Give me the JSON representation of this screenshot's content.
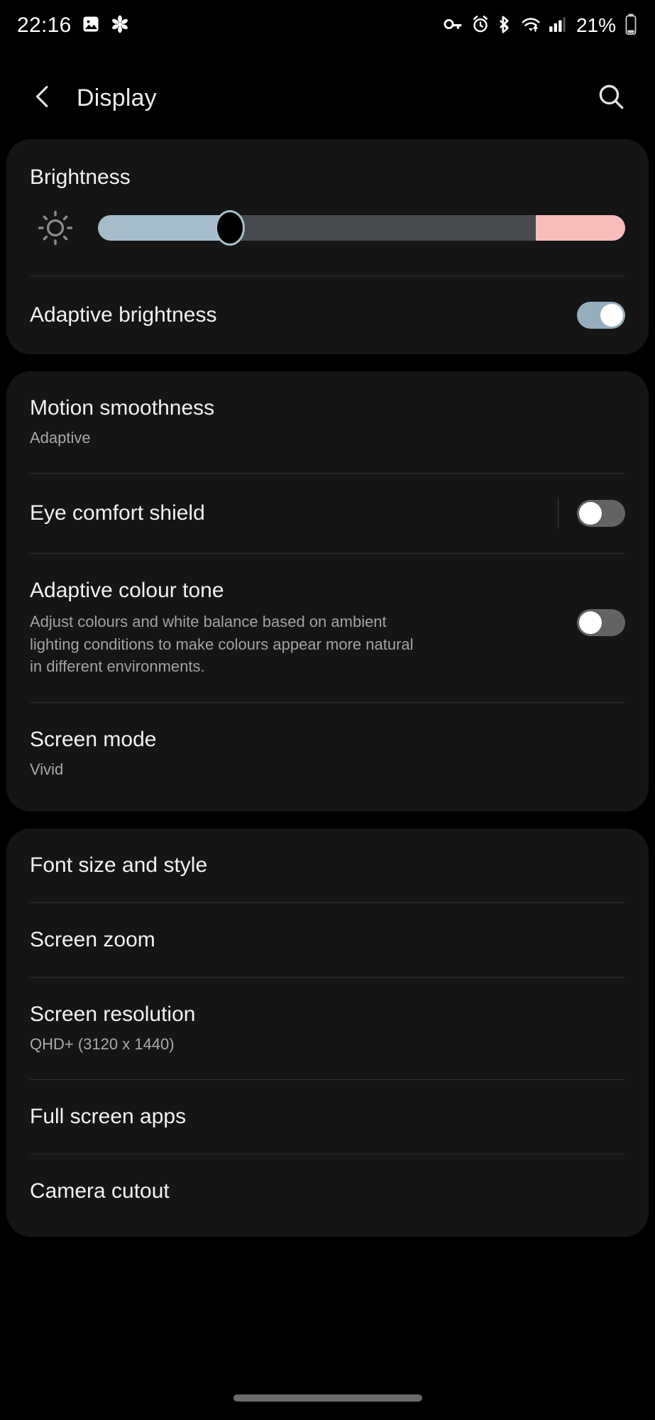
{
  "status_bar": {
    "time": "22:16",
    "left_icons": [
      "image-icon",
      "asterisk-icon"
    ],
    "right_icons": [
      "vpn-key-icon",
      "alarm-icon",
      "bluetooth-icon",
      "wifi-icon",
      "signal-icon"
    ],
    "battery_percent": "21%"
  },
  "app_bar": {
    "back_icon": "chevron-left-icon",
    "title": "Display",
    "search_icon": "search-icon"
  },
  "cards": [
    {
      "id": "brightness-card",
      "rows": [
        {
          "type": "header",
          "title": "Brightness"
        },
        {
          "type": "slider",
          "icon": "brightness-sun-icon",
          "value_percent": 25,
          "hot_zone_start_percent": 83,
          "fill_color": "#a6bcc9",
          "track_color": "#474b50",
          "hot_color": "#f7bdbb"
        },
        {
          "type": "toggle",
          "title": "Adaptive brightness",
          "state": "on"
        }
      ]
    },
    {
      "id": "display-quality-card",
      "rows": [
        {
          "type": "nav",
          "title": "Motion smoothness",
          "subtitle": "Adaptive"
        },
        {
          "type": "toggle-with-separator",
          "title": "Eye comfort shield",
          "state": "off"
        },
        {
          "type": "toggle-with-description",
          "title": "Adaptive colour tone",
          "description": "Adjust colours and white balance based on ambient lighting conditions to make colours appear more natural in different environments.",
          "state": "off"
        },
        {
          "type": "nav",
          "title": "Screen mode",
          "subtitle": "Vivid"
        }
      ]
    },
    {
      "id": "layout-card",
      "rows": [
        {
          "type": "nav",
          "title": "Font size and style"
        },
        {
          "type": "nav",
          "title": "Screen zoom"
        },
        {
          "type": "nav",
          "title": "Screen resolution",
          "subtitle": "QHD+ (3120 x 1440)"
        },
        {
          "type": "nav",
          "title": "Full screen apps"
        },
        {
          "type": "nav",
          "title": "Camera cutout"
        }
      ]
    }
  ],
  "navigation": {
    "gesture_bar": "home-gesture-bar"
  }
}
